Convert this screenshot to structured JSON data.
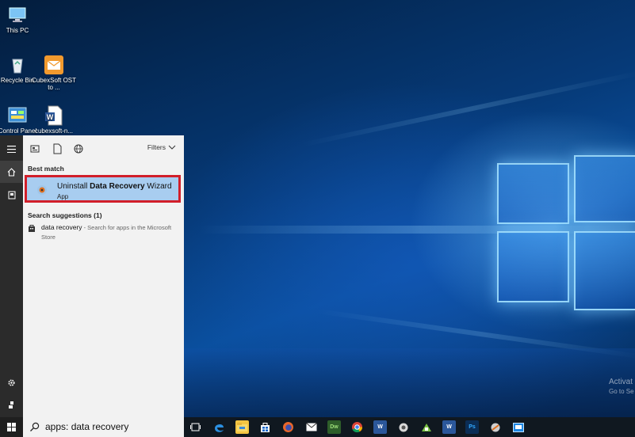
{
  "desktop": {
    "icons": [
      {
        "name": "This PC",
        "icon": "computer-icon"
      },
      {
        "name": "Recycle Bin",
        "icon": "recycle-bin-icon"
      },
      {
        "name": "CubexSoft OST to ...",
        "icon": "envelope-app-icon"
      },
      {
        "name": "Control Panel",
        "icon": "control-panel-icon"
      },
      {
        "name": "cubexsoft-n...",
        "icon": "word-document-icon"
      }
    ],
    "watermark": {
      "line1": "Activat",
      "line2": "Go to Se"
    }
  },
  "start_menu": {
    "rail": [
      "hamburger-icon",
      "home-icon",
      "documents-icon",
      "gear-icon",
      "user-icon"
    ],
    "toolbar": {
      "icons": [
        "apps-icon",
        "documents-icon",
        "web-icon"
      ],
      "filters_label": "Filters"
    },
    "best_match": {
      "header": "Best match",
      "title_prefix": "Uninstall ",
      "title_bold": "Data Recovery",
      "title_suffix": " Wizard",
      "subtitle": "App"
    },
    "suggestions": {
      "header": "Search suggestions (1)",
      "items": [
        {
          "term": "data recovery",
          "detail": " - Search for apps in the Microsoft",
          "detail2": "Store"
        }
      ]
    }
  },
  "taskbar": {
    "search_value": "apps: data recovery",
    "pinned": [
      "task-view-icon",
      "edge-icon",
      "file-explorer-icon",
      "store-icon",
      "firefox-icon",
      "mail-icon",
      "dreamweaver-icon",
      "chrome-icon",
      "word-icon",
      "app-icon",
      "app-icon",
      "word-icon",
      "photoshop-icon",
      "app-icon",
      "app-icon"
    ]
  }
}
